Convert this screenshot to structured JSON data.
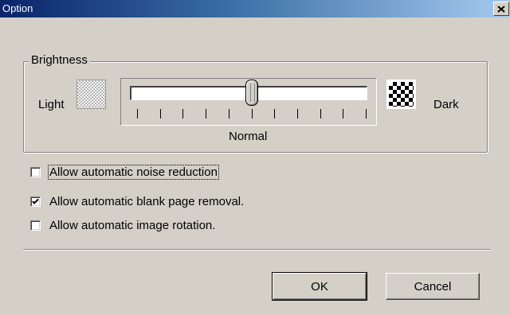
{
  "window": {
    "title": "Option"
  },
  "brightness": {
    "group_label": "Brightness",
    "min_label": "Light",
    "max_label": "Dark",
    "center_label": "Normal",
    "slider_value": 0.5
  },
  "options": [
    {
      "label": "Allow automatic noise reduction",
      "checked": false,
      "focused": true
    },
    {
      "label": "Allow automatic blank page removal.",
      "checked": true,
      "focused": false
    },
    {
      "label": "Allow automatic image rotation.",
      "checked": false,
      "focused": false
    }
  ],
  "buttons": {
    "ok": "OK",
    "cancel": "Cancel"
  },
  "icons": {
    "close": "close-icon",
    "check": "check-icon"
  }
}
